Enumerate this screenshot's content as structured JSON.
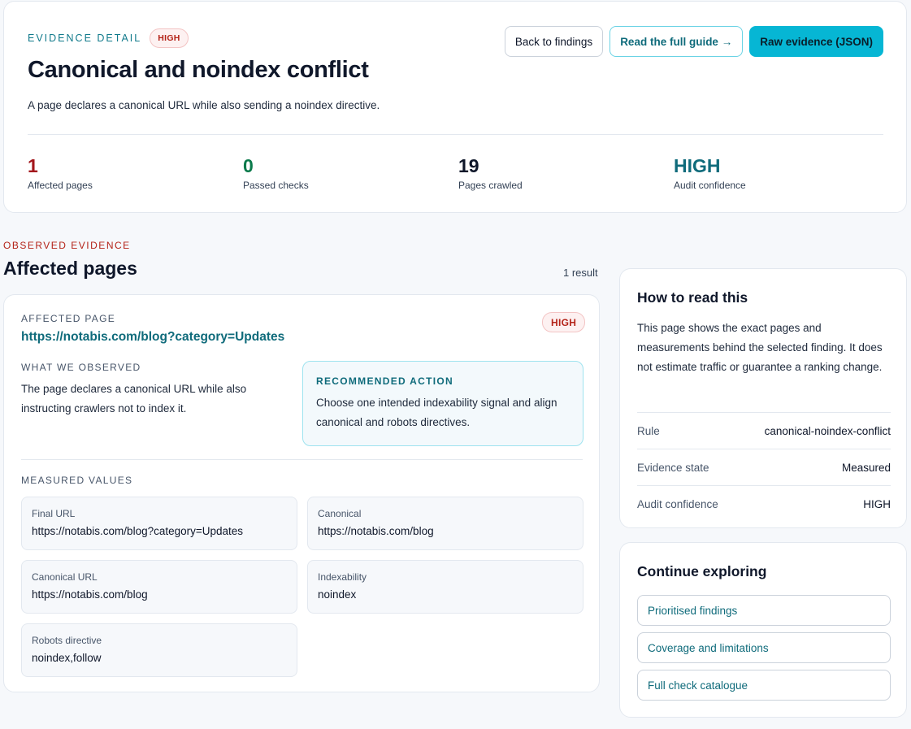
{
  "header": {
    "eyebrow": "EVIDENCE DETAIL",
    "severity": "HIGH",
    "title": "Canonical and noindex conflict",
    "description": "A page declares a canonical URL while also sending a noindex directive.",
    "buttons": {
      "back": "Back to findings",
      "guide": "Read the full guide →",
      "raw": "Raw evidence (JSON)"
    },
    "stats": [
      {
        "value": "1",
        "label": "Affected pages",
        "color": "#a3161c"
      },
      {
        "value": "0",
        "label": "Passed checks",
        "color": "#0b7a4b"
      },
      {
        "value": "19",
        "label": "Pages crawled",
        "color": "#0f172a"
      },
      {
        "value": "HIGH",
        "label": "Audit confidence",
        "color": "#0f6b7b"
      }
    ]
  },
  "section": {
    "eyebrow": "OBSERVED EVIDENCE",
    "title": "Affected pages",
    "count": "1 result"
  },
  "finding": {
    "page_label": "AFFECTED PAGE",
    "page_url": "https://notabis.com/blog?category=Updates",
    "severity": "HIGH",
    "observed_label": "WHAT WE OBSERVED",
    "observed_text": "The page declares a canonical URL while also instructing crawlers not to index it.",
    "action_label": "RECOMMENDED ACTION",
    "action_text": "Choose one intended indexability signal and align canonical and robots directives.",
    "measured_label": "MEASURED VALUES",
    "measured": [
      {
        "label": "Final URL",
        "value": "https://notabis.com/blog?category=Updates"
      },
      {
        "label": "Canonical",
        "value": "https://notabis.com/blog"
      },
      {
        "label": "Canonical URL",
        "value": "https://notabis.com/blog"
      },
      {
        "label": "Indexability",
        "value": "noindex"
      },
      {
        "label": "Robots directive",
        "value": "noindex,follow"
      }
    ]
  },
  "howto": {
    "title": "How to read this",
    "text": "This page shows the exact pages and measurements behind the selected finding. It does not estimate traffic or guarantee a ranking change.",
    "rows": [
      {
        "key": "Rule",
        "value": "canonical-noindex-conflict"
      },
      {
        "key": "Evidence state",
        "value": "Measured"
      },
      {
        "key": "Audit confidence",
        "value": "HIGH"
      }
    ]
  },
  "explore": {
    "title": "Continue exploring",
    "links": [
      "Prioritised findings",
      "Coverage and limitations",
      "Full check catalogue"
    ]
  }
}
